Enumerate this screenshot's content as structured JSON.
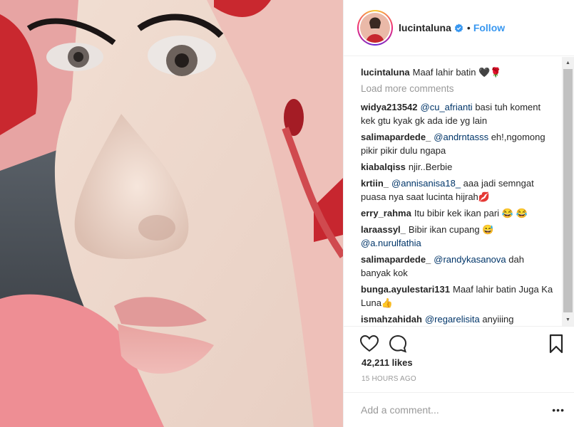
{
  "post": {
    "username": "lucintaluna",
    "follow_label": "Follow",
    "separator": "•"
  },
  "caption": {
    "user": "lucintaluna",
    "text": "Maaf lahir batin 🖤🌹"
  },
  "load_more_label": "Load more comments",
  "comments": [
    {
      "user": "widya213542",
      "mention": "@cu_afrianti",
      "text": " basi tuh koment kek gtu kyak gk ada ide yg lain"
    },
    {
      "user": "salimapardede_",
      "mention": "@andrntasss",
      "text": " eh!,ngomong pikir pikir dulu ngapa"
    },
    {
      "user": "kiabalqiss",
      "mention": "",
      "text": "njir..Berbie"
    },
    {
      "user": "krtiin_",
      "mention": "@annisanisa18_",
      "text": " aaa jadi semngat puasa nya saat lucinta hijrah💋"
    },
    {
      "user": "erry_rahma",
      "mention": "",
      "text": "Itu bibir kek ikan pari 😂 😂"
    },
    {
      "user": "laraassyl_",
      "mention": "",
      "text": "Bibir ikan cupang 😅 ",
      "mention_after": "@a.nurulfathia"
    },
    {
      "user": "salimapardede_",
      "mention": "@randykasanova",
      "text": " dah banyak kok"
    },
    {
      "user": "bunga.ayulestari131",
      "mention": "",
      "text": "Maaf lahir batin Juga Ka Luna👍"
    },
    {
      "user": "ismahzahidah",
      "mention": "@regarelisita",
      "text": " anyiiing"
    }
  ],
  "likes": "42,211 likes",
  "timestamp": "15 HOURS AGO",
  "add_comment_placeholder": "Add a comment...",
  "more_options": "•••",
  "icons": {
    "like": "heart-icon",
    "comment": "comment-bubble-icon",
    "save": "bookmark-icon",
    "verified": "verified-badge-icon"
  },
  "colors": {
    "link": "#3897f0",
    "mention": "#003569",
    "verified": "#3897f0",
    "muted": "#999999"
  }
}
